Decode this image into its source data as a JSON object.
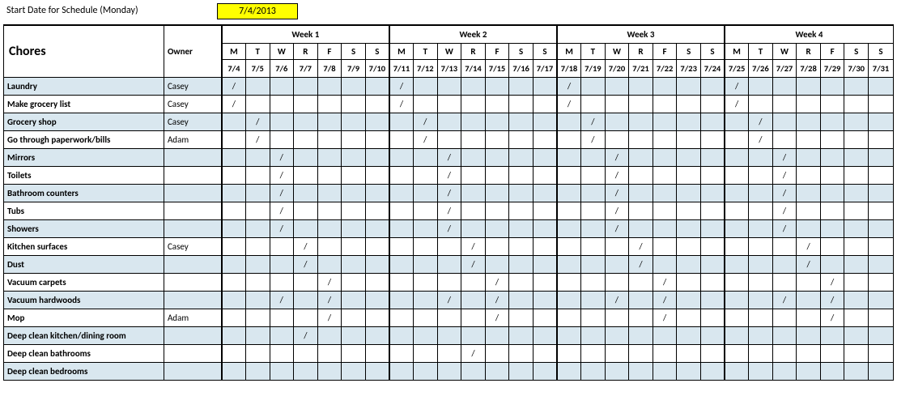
{
  "top": {
    "label": "Start Date for Schedule (Monday)",
    "date": "7/4/2013"
  },
  "headers": {
    "chores": "Chores",
    "owner": "Owner",
    "weeks": [
      "Week 1",
      "Week 2",
      "Week 3",
      "Week 4"
    ],
    "dow": [
      "M",
      "T",
      "W",
      "R",
      "F",
      "S",
      "S"
    ],
    "dates": [
      "7/4",
      "7/5",
      "7/6",
      "7/7",
      "7/8",
      "7/9",
      "7/10",
      "7/11",
      "7/12",
      "7/13",
      "7/14",
      "7/15",
      "7/16",
      "7/17",
      "7/18",
      "7/19",
      "7/20",
      "7/21",
      "7/22",
      "7/23",
      "7/24",
      "7/25",
      "7/26",
      "7/27",
      "7/28",
      "7/29",
      "7/30",
      "7/31"
    ]
  },
  "rows": [
    {
      "name": "Laundry",
      "owner": "Casey",
      "marks": [
        0,
        7,
        14,
        21
      ]
    },
    {
      "name": "Make grocery list",
      "owner": "Casey",
      "marks": [
        0,
        7,
        14,
        21
      ]
    },
    {
      "name": "Grocery shop",
      "owner": "Casey",
      "marks": [
        1,
        8,
        15,
        22
      ]
    },
    {
      "name": "Go through paperwork/bills",
      "owner": "Adam",
      "marks": [
        1,
        8,
        15,
        22
      ]
    },
    {
      "name": "Mirrors",
      "owner": "",
      "marks": [
        2,
        9,
        16,
        23
      ]
    },
    {
      "name": "Toilets",
      "owner": "",
      "marks": [
        2,
        9,
        16,
        23
      ]
    },
    {
      "name": "Bathroom counters",
      "owner": "",
      "marks": [
        2,
        9,
        16,
        23
      ]
    },
    {
      "name": "Tubs",
      "owner": "",
      "marks": [
        2,
        9,
        16,
        23
      ]
    },
    {
      "name": "Showers",
      "owner": "",
      "marks": [
        2,
        9,
        16,
        23
      ]
    },
    {
      "name": "Kitchen surfaces",
      "owner": "Casey",
      "marks": [
        3,
        10,
        17,
        24
      ]
    },
    {
      "name": "Dust",
      "owner": "",
      "marks": [
        3,
        10,
        17,
        24
      ]
    },
    {
      "name": "Vacuum carpets",
      "owner": "",
      "marks": [
        4,
        11,
        18,
        25
      ]
    },
    {
      "name": "Vacuum hardwoods",
      "owner": "",
      "marks": [
        2,
        4,
        9,
        11,
        16,
        18,
        23,
        25
      ]
    },
    {
      "name": "Mop",
      "owner": "Adam",
      "marks": [
        4,
        11,
        18,
        25
      ]
    },
    {
      "name": "Deep clean kitchen/dining room",
      "owner": "",
      "marks": [
        3
      ]
    },
    {
      "name": "Deep clean bathrooms",
      "owner": "",
      "marks": [
        10
      ]
    },
    {
      "name": "Deep clean bedrooms",
      "owner": "",
      "marks": []
    }
  ],
  "mark": "/"
}
